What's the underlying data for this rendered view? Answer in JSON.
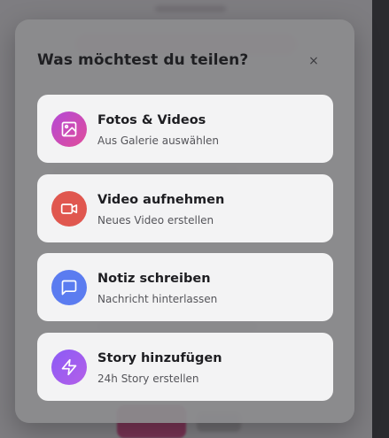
{
  "modal": {
    "title": "Was möchtest du teilen?",
    "close_label": "×"
  },
  "options": [
    {
      "title": "Fotos & Videos",
      "subtitle": "Aus Galerie auswählen",
      "icon": "image-icon",
      "color": "#c94fc0"
    },
    {
      "title": "Video aufnehmen",
      "subtitle": "Neues Video erstellen",
      "icon": "video-camera-icon",
      "color": "#e0574f"
    },
    {
      "title": "Notiz schreiben",
      "subtitle": "Nachricht hinterlassen",
      "icon": "message-icon",
      "color": "#5b7cf0"
    },
    {
      "title": "Story hinzufügen",
      "subtitle": "24h Story erstellen",
      "icon": "lightning-icon",
      "color": "#a45ef0"
    }
  ],
  "colors": {
    "overlay": "#1e1e22",
    "modal": "#8c8c8e",
    "card": "#f3f3f4"
  }
}
